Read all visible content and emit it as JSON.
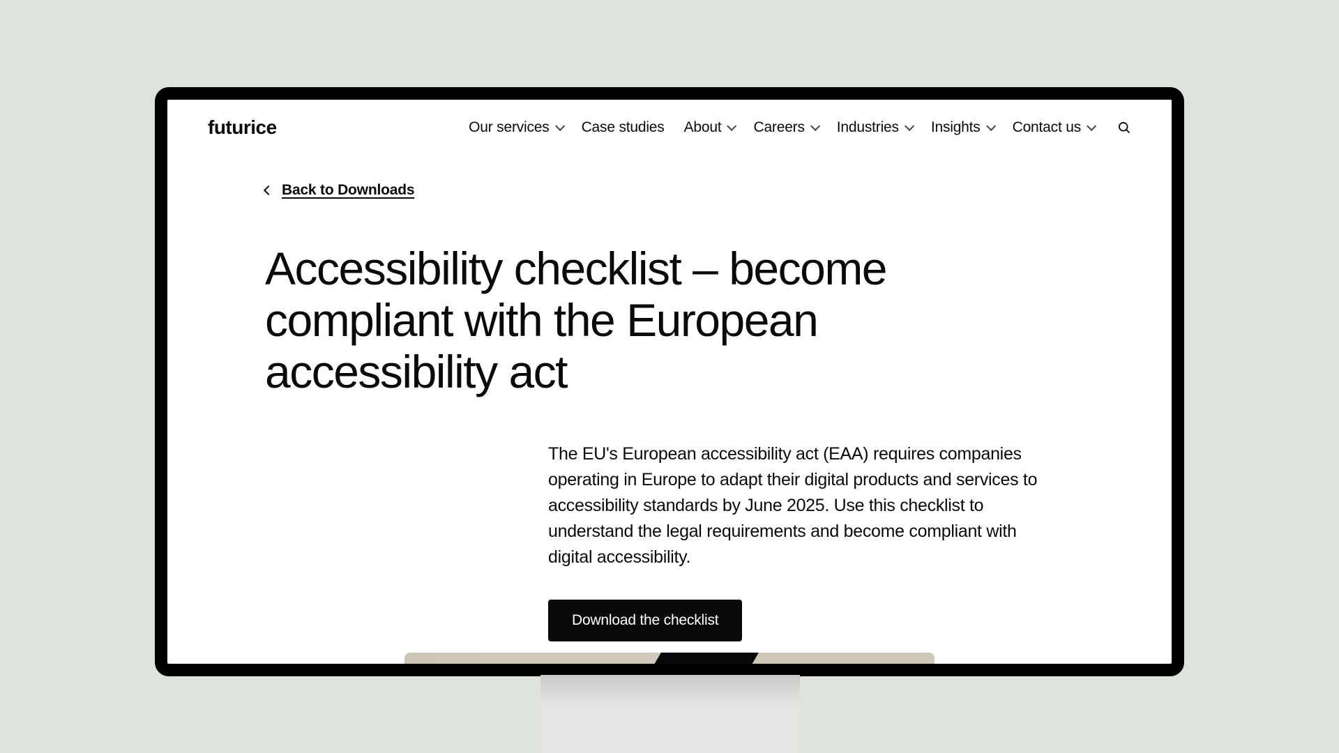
{
  "brand": {
    "logo": "futurice"
  },
  "nav": {
    "items": [
      {
        "label": "Our services",
        "dropdown": true
      },
      {
        "label": "Case studies",
        "dropdown": false
      },
      {
        "label": "About",
        "dropdown": true
      },
      {
        "label": "Careers",
        "dropdown": true
      },
      {
        "label": "Industries",
        "dropdown": true
      },
      {
        "label": "Insights",
        "dropdown": true
      },
      {
        "label": "Contact us",
        "dropdown": true
      }
    ]
  },
  "back_link": {
    "label": "Back to Downloads"
  },
  "main": {
    "title": "Accessibility checklist – become compliant with the European accessibility act",
    "body": "The EU's European accessibility act (EAA) requires companies operating in Europe to adapt their digital products and services to accessibility standards by June 2025. Use this checklist to understand the legal requirements and become compliant with digital accessibility.",
    "cta_label": "Download the checklist"
  }
}
